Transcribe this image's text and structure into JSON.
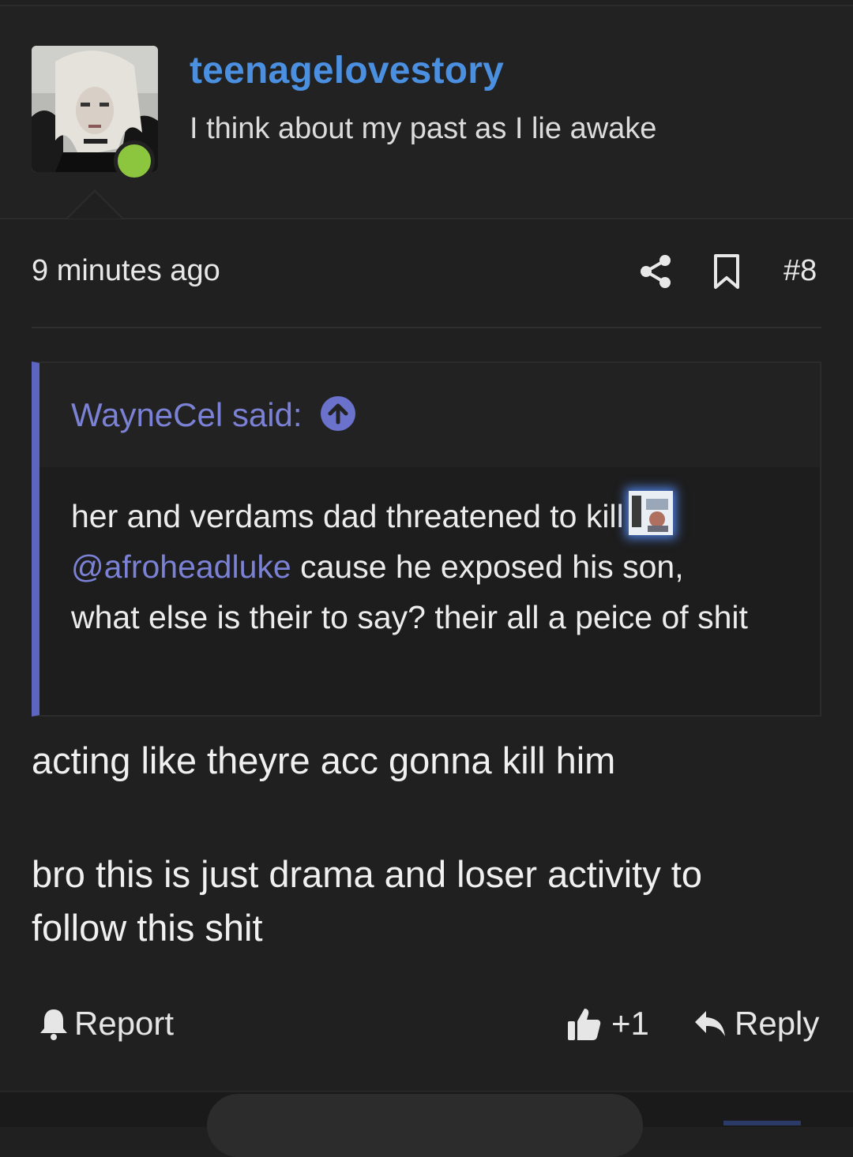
{
  "user": {
    "username": "teenagelovestory",
    "title": "I think about my past as I lie awake",
    "online_status_color": "#8cc63f",
    "avatar_icon": "avatar-photo"
  },
  "post": {
    "timestamp": "9 minutes ago",
    "number": "#8",
    "share_icon": "share-icon",
    "bookmark_icon": "bookmark-icon"
  },
  "quote": {
    "author_label": "WayneCel said:",
    "text_part1": "her and verdams dad threatened to kill",
    "mention": "@afroheadluke",
    "text_part2": " cause he exposed his son, what else is their to say? their all a peice of shit",
    "accent_color": "#5c65c0"
  },
  "body": {
    "line1": "acting like theyre acc gonna kill him",
    "line2": "bro this is just drama and loser activity to follow this shit"
  },
  "actions": {
    "report_label": "Report",
    "like_count": "+1",
    "reply_label": "Reply"
  },
  "colors": {
    "background": "#202020",
    "username": "#4a8fe0",
    "link": "#7b82d6"
  }
}
